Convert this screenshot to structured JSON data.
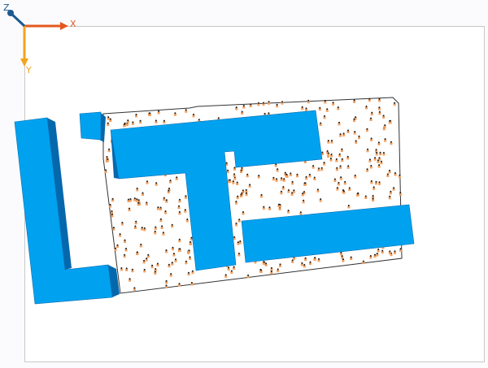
{
  "axes": {
    "x_label": "X",
    "y_label": "Y",
    "z_label": "Z",
    "x_color": "#e4571e",
    "y_color": "#f5a31a",
    "z_color": "#1c5a8f"
  },
  "scene": {
    "building_color": "#00a2f0",
    "building_side_color": "#0568ad",
    "site_outline_color": "#333333",
    "agent_colors": [
      "#f0a060",
      "#1a1a1a"
    ],
    "icons": [
      "axis-gizmo-icon"
    ]
  }
}
